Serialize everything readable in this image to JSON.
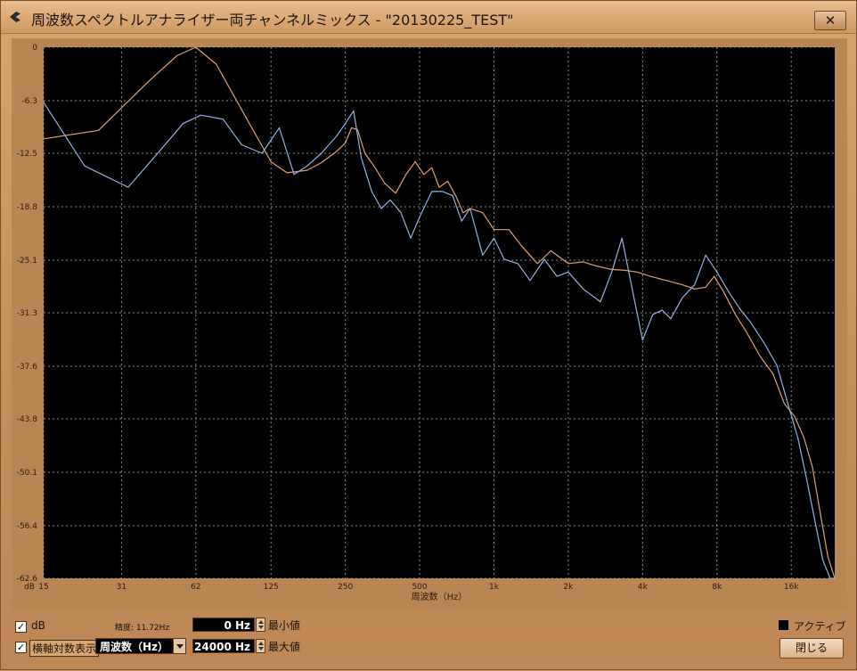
{
  "window": {
    "title": "周波数スペクトルアナライザー両チャンネルミックス - \"20130225_TEST\"",
    "close_label": "✕"
  },
  "chart_data": {
    "type": "line",
    "title": "",
    "xlabel": "周波数（Hz）",
    "ylabel": "dB",
    "x_scale": "log",
    "x_ticks": [
      15,
      31,
      62,
      125,
      250,
      500,
      1000,
      2000,
      4000,
      8000,
      16000
    ],
    "x_tick_labels": [
      "15",
      "31",
      "62",
      "125",
      "250",
      "500",
      "1k",
      "2k",
      "4k",
      "8k",
      "16k"
    ],
    "xlim": [
      15,
      24000
    ],
    "y_ticks": [
      0,
      -6.3,
      -12.5,
      -18.8,
      -25.1,
      -31.3,
      -37.6,
      -43.8,
      -50.1,
      -56.4,
      -62.6
    ],
    "y_tick_labels": [
      "0",
      "-6.3",
      "-12.5",
      "-18.8",
      "-25.1",
      "-31.3",
      "-37.6",
      "-43.8",
      "-50.1",
      "-56.4",
      "-62.6"
    ],
    "ylim": [
      -62.6,
      0
    ],
    "grid": true,
    "series": [
      {
        "color": "#e2a06a",
        "x": [
          15,
          25,
          40,
          52,
          62,
          75,
          100,
          125,
          145,
          175,
          200,
          230,
          250,
          265,
          280,
          300,
          330,
          360,
          400,
          440,
          480,
          520,
          560,
          600,
          650,
          700,
          750,
          800,
          900,
          1000,
          1150,
          1300,
          1500,
          1700,
          2000,
          2300,
          2600,
          3000,
          3400,
          3800,
          4300,
          5000,
          5800,
          6500,
          7200,
          7800,
          8500,
          9500,
          10500,
          12000,
          13500,
          15000,
          16500,
          18000,
          19500,
          21000,
          22500,
          24000
        ],
        "y": [
          -10.8,
          -9.8,
          -4.0,
          -1.0,
          0,
          -2.0,
          -8.5,
          -13.5,
          -14.8,
          -14.5,
          -13.6,
          -12.3,
          -11.3,
          -9.5,
          -9.7,
          -12.5,
          -14.2,
          -16.0,
          -17.2,
          -15.0,
          -13.5,
          -15.0,
          -14.2,
          -16.5,
          -15.8,
          -17.5,
          -19.5,
          -19.0,
          -19.5,
          -21.5,
          -21.5,
          -23.5,
          -25.5,
          -24.0,
          -25.5,
          -25.3,
          -25.8,
          -26.2,
          -26.3,
          -26.5,
          -27.0,
          -27.5,
          -28.0,
          -28.5,
          -28.3,
          -27.0,
          -28.8,
          -31.5,
          -33.5,
          -36.5,
          -38.5,
          -42.0,
          -43.5,
          -46.0,
          -49.5,
          -55.0,
          -60.0,
          -63.0
        ]
      },
      {
        "color": "#8fb3e6",
        "x": [
          15,
          22,
          33,
          45,
          55,
          65,
          80,
          95,
          115,
          135,
          155,
          175,
          200,
          230,
          250,
          270,
          290,
          320,
          350,
          380,
          420,
          460,
          500,
          560,
          620,
          680,
          740,
          800,
          900,
          1000,
          1100,
          1250,
          1400,
          1600,
          1800,
          2000,
          2300,
          2700,
          3000,
          3300,
          3600,
          4000,
          4400,
          4800,
          5200,
          5800,
          6500,
          7200,
          8000,
          9000,
          10000,
          11000,
          12500,
          14000,
          15500,
          17000,
          18500,
          20000,
          21500,
          23000,
          24000
        ],
        "y": [
          -6.5,
          -14.0,
          -16.5,
          -12.0,
          -9.0,
          -8.0,
          -8.5,
          -11.5,
          -12.5,
          -9.5,
          -15.0,
          -14.0,
          -12.5,
          -10.5,
          -9.0,
          -7.5,
          -13.0,
          -17.0,
          -19.0,
          -18.0,
          -19.5,
          -22.5,
          -20.0,
          -17.0,
          -17.0,
          -17.5,
          -20.5,
          -19.0,
          -24.5,
          -22.5,
          -25.0,
          -25.5,
          -27.5,
          -25.0,
          -27.0,
          -26.5,
          -28.5,
          -30.0,
          -26.5,
          -22.5,
          -28.0,
          -34.5,
          -31.5,
          -31.0,
          -32.0,
          -29.5,
          -28.0,
          -24.5,
          -26.5,
          -29.0,
          -31.0,
          -32.5,
          -35.0,
          -37.5,
          -42.0,
          -46.0,
          -51.0,
          -56.0,
          -60.5,
          -63.5,
          -64.5
        ]
      }
    ]
  },
  "controls": {
    "db_label": "dB",
    "log_axis_label": "横軸対数表示",
    "resolution_label": "精度: 11.72Hz",
    "min_value": "0 Hz",
    "min_label": "最小値",
    "max_value": "24000 Hz",
    "max_label": "最大値",
    "axis_select_value": "周波数（Hz）",
    "active_label": "アクティブ",
    "close_button_label": "閉じる"
  }
}
